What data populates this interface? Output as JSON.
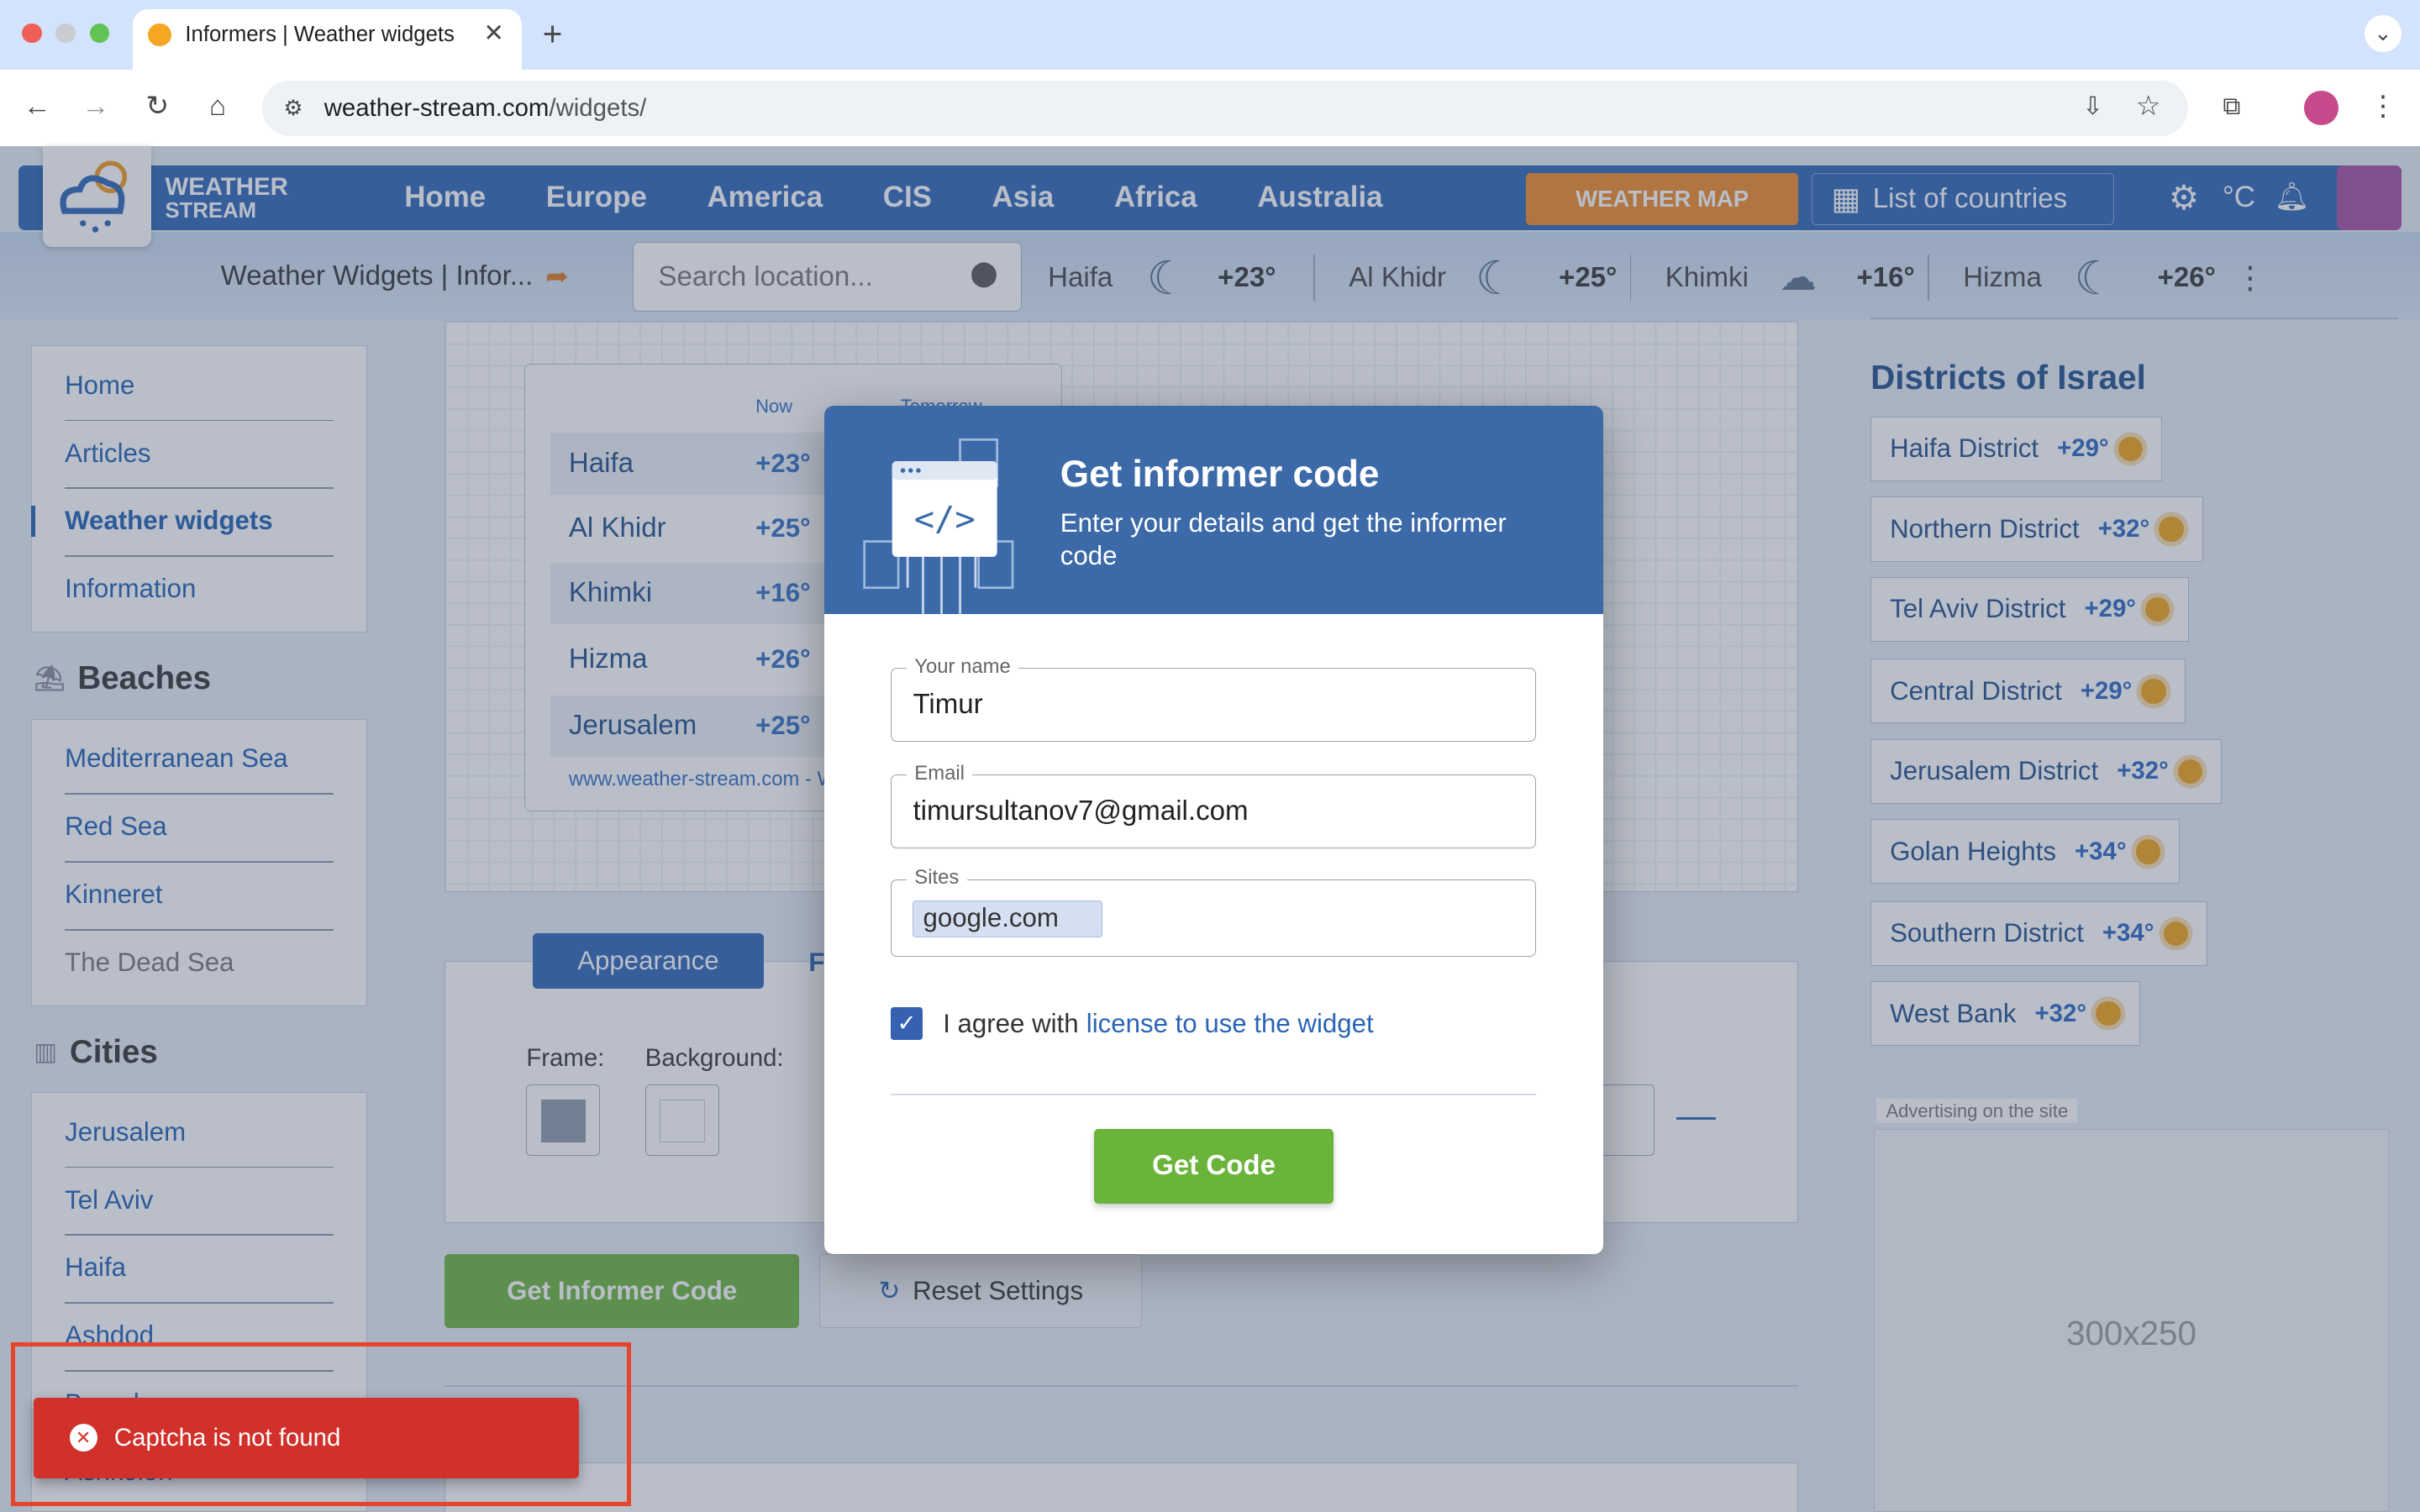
{
  "browser": {
    "tab_title": "Informers | Weather widgets",
    "url_host": "weather-stream.com",
    "url_path": "/widgets/"
  },
  "site": {
    "logo_line1": "WEATHER",
    "logo_line2": "STREAM",
    "nav": [
      "Home",
      "Europe",
      "America",
      "CIS",
      "Asia",
      "Africa",
      "Australia"
    ],
    "weather_map": "WEATHER MAP",
    "list_countries": "List of countries",
    "unit": "°C",
    "breadcrumb": "Weather Widgets | Infor...",
    "search_placeholder": "Search location...",
    "ticker": [
      {
        "city": "Haifa",
        "temp": "+23°",
        "icon": "moon-icon"
      },
      {
        "city": "Al Khidr",
        "temp": "+25°",
        "icon": "moon-icon"
      },
      {
        "city": "Khimki",
        "temp": "+16°",
        "icon": "snow-cloud-icon"
      },
      {
        "city": "Hizma",
        "temp": "+26°",
        "icon": "moon-icon"
      }
    ]
  },
  "sidebar": {
    "menu": [
      "Home",
      "Articles",
      "Weather widgets",
      "Information"
    ],
    "beaches_title": "Beaches",
    "beaches": [
      "Mediterranean Sea",
      "Red Sea",
      "Kinneret",
      "The Dead Sea"
    ],
    "cities_title": "Cities",
    "cities": [
      "Jerusalem",
      "Tel Aviv",
      "Haifa",
      "Ashdod",
      "Beersheva",
      "Ashkelon"
    ]
  },
  "preview": {
    "col_now": "Now",
    "col_tomorrow": "Tomorrow",
    "rows": [
      {
        "city": "Haifa",
        "temp": "+23°"
      },
      {
        "city": "Al Khidr",
        "temp": "+25°"
      },
      {
        "city": "Khimki",
        "temp": "+16°"
      },
      {
        "city": "Hizma",
        "temp": "+26°"
      },
      {
        "city": "Jerusalem",
        "temp": "+25°"
      }
    ],
    "footer": "www.weather-stream.com - W"
  },
  "settings": {
    "tab_appearance": "Appearance",
    "tab_second": "F",
    "frame_label": "Frame:",
    "background_label": "Background:",
    "frame_color": "#8f9aa8",
    "get_informer": "Get Informer Code",
    "reset": "Reset Settings"
  },
  "districts": {
    "title": "Districts of Israel",
    "items": [
      {
        "name": "Haifa District",
        "temp": "+29°"
      },
      {
        "name": "Northern District",
        "temp": "+32°"
      },
      {
        "name": "Tel Aviv District",
        "temp": "+29°"
      },
      {
        "name": "Central District",
        "temp": "+29°"
      },
      {
        "name": "Jerusalem District",
        "temp": "+32°"
      },
      {
        "name": "Golan Heights",
        "temp": "+34°"
      },
      {
        "name": "Southern District",
        "temp": "+34°"
      },
      {
        "name": "West Bank",
        "temp": "+32°"
      }
    ],
    "ad_label": "Advertising on the site",
    "ad_size": "300x250"
  },
  "modal": {
    "title": "Get informer code",
    "subtitle": "Enter your details and get the informer code",
    "name_label": "Your name",
    "name_value": "Timur",
    "email_label": "Email",
    "email_value": "timursultanov7@gmail.com",
    "sites_label": "Sites",
    "site_chip": "google.com",
    "agree_prefix": "I agree with",
    "agree_link": "license to use the widget",
    "submit": "Get Code"
  },
  "toast": {
    "message": "Captcha is not found",
    "color": "#d2312b"
  }
}
